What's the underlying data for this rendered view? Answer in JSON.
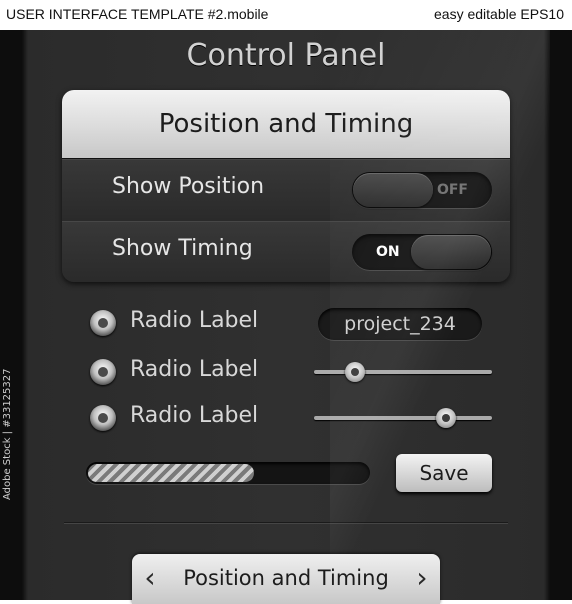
{
  "header_strip": {
    "left": "USER INTERFACE TEMPLATE #2.mobile",
    "right": "easy editable EPS10"
  },
  "side_text": "Adobe Stock | #33125327",
  "panel": {
    "title": "Control Panel"
  },
  "card": {
    "title": "Position and Timing",
    "rows": [
      {
        "label": "Show Position",
        "toggle_state": "OFF",
        "on": false
      },
      {
        "label": "Show Timing",
        "toggle_state": "ON",
        "on": true
      }
    ]
  },
  "options": [
    {
      "label": "Radio Label"
    },
    {
      "label": "Radio Label"
    },
    {
      "label": "Radio Label"
    }
  ],
  "text_field": {
    "value": "project_234"
  },
  "sliders": [
    {
      "value": 0.23
    },
    {
      "value": 0.74
    }
  ],
  "progress": {
    "value": 0.6
  },
  "save_button": {
    "label": "Save"
  },
  "nav": {
    "title": "Position and Timing",
    "prev_icon": "chevron-left-icon",
    "next_icon": "chevron-right-icon"
  },
  "colors": {
    "panel_bg": "#303030",
    "card_header": "#dcdcdc",
    "text_light": "#e6e6e6"
  }
}
